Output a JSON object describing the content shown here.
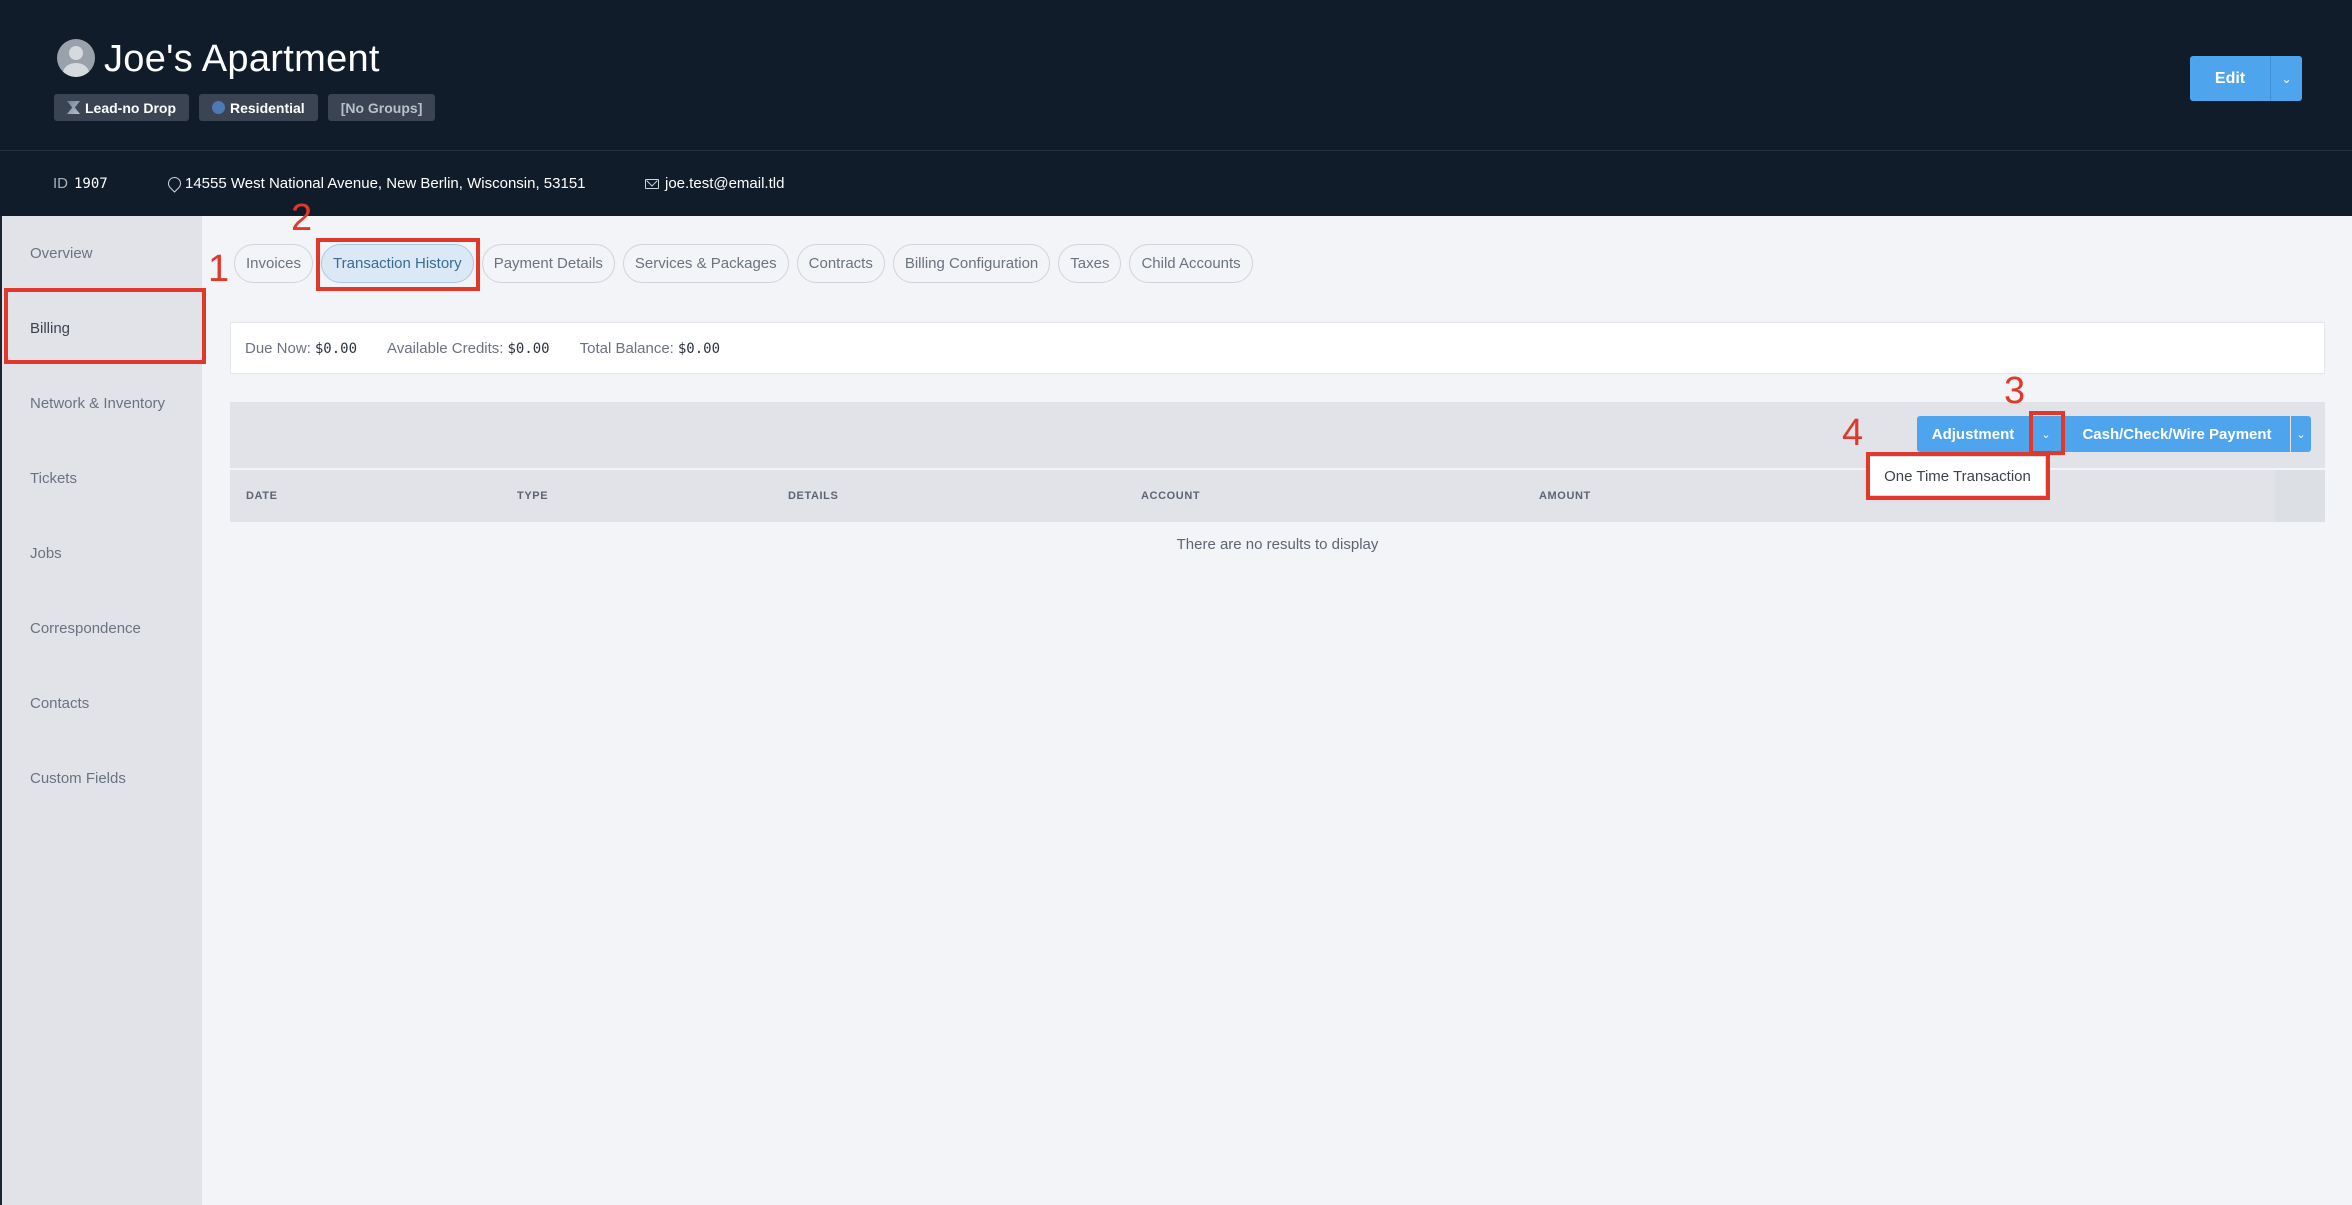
{
  "header": {
    "title": "Joe's Apartment",
    "tags": [
      "Lead-no Drop",
      "Residential",
      "[No Groups]"
    ],
    "edit_label": "Edit",
    "caret": "⌄"
  },
  "info": {
    "id_label": "ID",
    "id_value": "1907",
    "address": "14555 West National Avenue, New Berlin, Wisconsin, 53151",
    "email": "joe.test@email.tld"
  },
  "sidebar": {
    "items": [
      {
        "label": "Overview"
      },
      {
        "label": "Billing"
      },
      {
        "label": "Network & Inventory"
      },
      {
        "label": "Tickets"
      },
      {
        "label": "Jobs"
      },
      {
        "label": "Correspondence"
      },
      {
        "label": "Contacts"
      },
      {
        "label": "Custom Fields"
      }
    ],
    "active": "Billing"
  },
  "tabs": [
    {
      "label": "Invoices"
    },
    {
      "label": "Transaction History"
    },
    {
      "label": "Payment Details"
    },
    {
      "label": "Services & Packages"
    },
    {
      "label": "Contracts"
    },
    {
      "label": "Billing Configuration"
    },
    {
      "label": "Taxes"
    },
    {
      "label": "Child Accounts"
    }
  ],
  "balance": {
    "due_label": "Due Now:",
    "due_value": "$0.00",
    "credits_label": "Available Credits:",
    "credits_value": "$0.00",
    "total_label": "Total Balance:",
    "total_value": "$0.00"
  },
  "toolbar": {
    "adjustment_label": "Adjustment",
    "cash_label": "Cash/Check/Wire Payment",
    "dropdown_item": "One Time Transaction"
  },
  "table": {
    "columns": [
      "DATE",
      "TYPE",
      "DETAILS",
      "ACCOUNT",
      "AMOUNT"
    ],
    "empty_text": "There are no results to display"
  },
  "annotations": [
    "1",
    "2",
    "3",
    "4"
  ],
  "colors": {
    "header_bg": "#111c2b",
    "accent": "#4fa4ee",
    "annotation": "#e0392b"
  }
}
